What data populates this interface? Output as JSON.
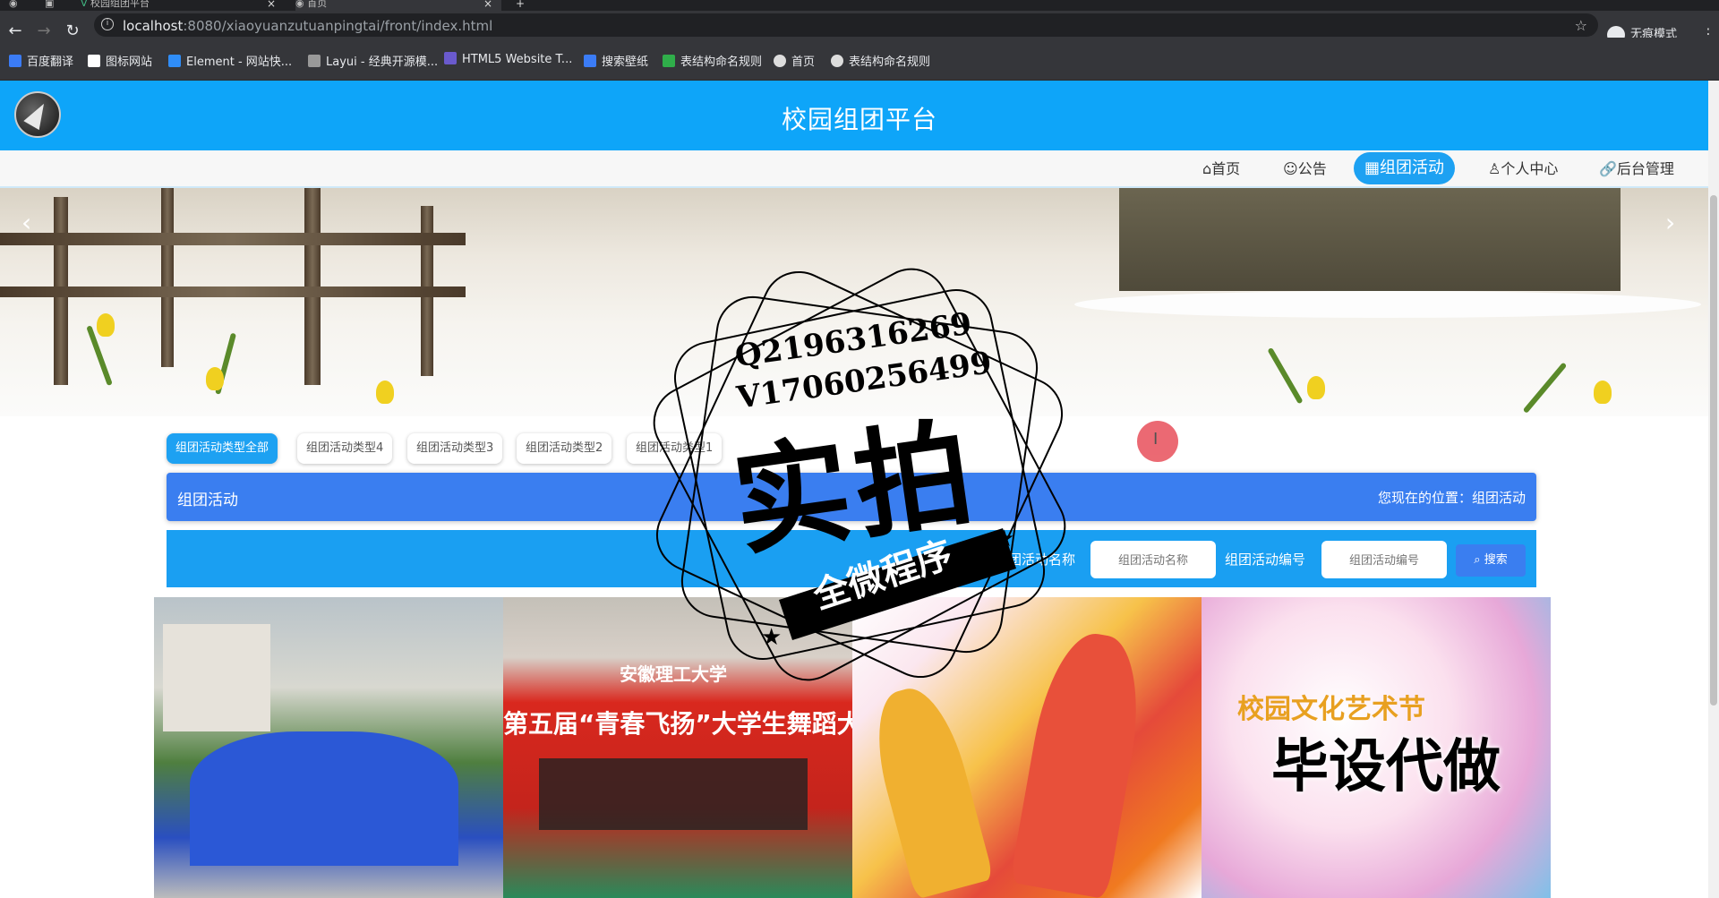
{
  "browser": {
    "tabs": [
      {
        "label": "校园组团平台"
      },
      {
        "label": "首页"
      }
    ],
    "url_host": "localhost",
    "url_path": ":8080/xiaoyuanzutuanpingtai/front/index.html",
    "incognito_label": "无痕模式",
    "bookmarks": [
      {
        "label": "百度翻译",
        "color": "#3b7cf6"
      },
      {
        "label": "图标网站",
        "color": "#ffffff"
      },
      {
        "label": "Element - 网站快...",
        "color": "#2f8df7"
      },
      {
        "label": "Layui - 经典开源模...",
        "color": "#999999"
      },
      {
        "label": "HTML5 Website T...",
        "color": "#6a5acd"
      },
      {
        "label": "搜索壁纸",
        "color": "#3b7cf6"
      },
      {
        "label": "表结构命名规则",
        "color": "#2fae4a"
      },
      {
        "label": "首页",
        "color": "#dddddd"
      },
      {
        "label": "表结构命名规则",
        "color": "#dddddd"
      }
    ]
  },
  "site": {
    "title": "校园组团平台",
    "nav": [
      {
        "label": "首页",
        "icon": "home-icon",
        "active": false
      },
      {
        "label": "公告",
        "icon": "notice-icon",
        "active": false
      },
      {
        "label": "组团活动",
        "icon": "activity-icon",
        "active": true
      },
      {
        "label": "个人中心",
        "icon": "user-icon",
        "active": false
      },
      {
        "label": "后台管理",
        "icon": "link-icon",
        "active": false
      }
    ]
  },
  "categories": [
    {
      "label": "组团活动类型全部",
      "active": true
    },
    {
      "label": "组团活动类型4",
      "active": false
    },
    {
      "label": "组团活动类型3",
      "active": false
    },
    {
      "label": "组团活动类型2",
      "active": false
    },
    {
      "label": "组团活动类型1",
      "active": false
    }
  ],
  "section": {
    "title": "组团活动",
    "location": "您现在的位置：组团活动"
  },
  "search": {
    "name_label": "组团活动名称",
    "name_placeholder": "组团活动名称",
    "code_label": "组团活动编号",
    "code_placeholder": "组团活动编号",
    "button": "搜索"
  },
  "cards": [
    {
      "caption": ""
    },
    {
      "caption": "第五届“青春飞扬”大学生舞蹈大",
      "subcaption": "安徽理工大学"
    },
    {
      "caption": ""
    },
    {
      "caption": "毕设代做",
      "subcaption": "校园文化艺术节"
    }
  ],
  "watermark": {
    "line1": "Q2196316269",
    "line2": "V17060256499",
    "big": "实拍",
    "ribbon": "全微程序"
  },
  "colors": {
    "header": "#0ea5f9",
    "titlebar": "#3a7ef0",
    "searchbar": "#1a9ff2",
    "active_nav": "#1da1f2"
  }
}
